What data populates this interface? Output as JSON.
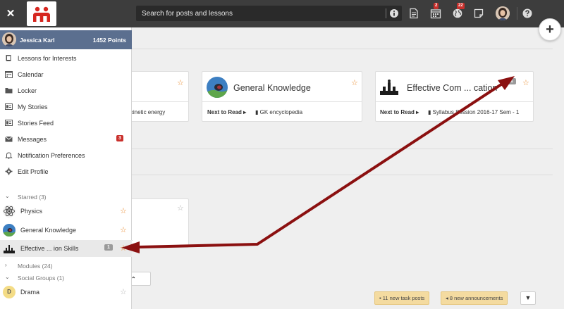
{
  "topbar": {
    "close_icon": "close-icon",
    "search_placeholder": "Search for posts and lessons",
    "calendar_badge": "2",
    "globe_badge": "22"
  },
  "user": {
    "name": "Jessica Karl",
    "points": "1452 Points"
  },
  "nav": [
    {
      "label": "Lessons for Interests",
      "icon": "book-icon"
    },
    {
      "label": "Calendar",
      "icon": "calendar-icon"
    },
    {
      "label": "Locker",
      "icon": "folder-icon"
    },
    {
      "label": "My Stories",
      "icon": "stories-icon"
    },
    {
      "label": "Stories Feed",
      "icon": "feed-icon"
    },
    {
      "label": "Messages",
      "icon": "envelope-icon",
      "badge": "3"
    },
    {
      "label": "Notification Preferences",
      "icon": "bell-icon"
    },
    {
      "label": "Edit Profile",
      "icon": "gear-icon"
    }
  ],
  "starred": {
    "header": "Starred (3)",
    "items": [
      {
        "label": "Physics"
      },
      {
        "label": "General Knowledge"
      },
      {
        "label": "Effective ... ion Skills",
        "count": "1"
      }
    ]
  },
  "modules_header": "Modules (24)",
  "social_header": "Social Groups (1)",
  "social_items": [
    {
      "label": "Drama",
      "initial": "D"
    }
  ],
  "cards": [
    {
      "title": "",
      "next_label": "",
      "next_value": "of kinetic energy"
    },
    {
      "title": "General Knowledge",
      "next_label": "Next to Read",
      "next_value": "GK encyclopedia"
    },
    {
      "title": "Effective Com ... cation",
      "next_label": "Next to Read",
      "next_value": "Syllabus Session 2016-17 Sem - 1",
      "count": "1"
    }
  ],
  "lower_card_text": "a",
  "groups_button": "ps",
  "notices": {
    "task_posts": "11 new task posts",
    "announcements": "8 new announcements"
  },
  "colors": {
    "topbar": "#3d3d3d",
    "user_bar": "#5b6f8f",
    "badge_red": "#c9302c",
    "star_orange": "#e8892b",
    "arrow_red": "#8b1010",
    "notice_yellow": "#f4dba0"
  }
}
